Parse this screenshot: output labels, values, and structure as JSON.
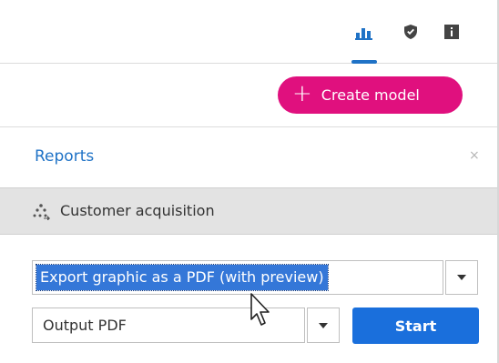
{
  "toolbar": {
    "tabs": [
      {
        "icon": "bar-chart-icon",
        "active": true
      },
      {
        "icon": "shield-icon",
        "active": false
      },
      {
        "icon": "info-icon",
        "active": false
      }
    ],
    "accent_color": "#1f72c6"
  },
  "create_model": {
    "plus": "+",
    "label": "Create model",
    "color": "#e0107e"
  },
  "reports": {
    "title": "Reports",
    "close": "×"
  },
  "section": {
    "icon": "hierarchy-icon",
    "label": "Customer acquisition"
  },
  "export": {
    "value": "Export graphic as a PDF (with preview)",
    "selected": true
  },
  "output": {
    "value": "Output PDF"
  },
  "start": {
    "label": "Start",
    "color": "#1a6fdc"
  }
}
